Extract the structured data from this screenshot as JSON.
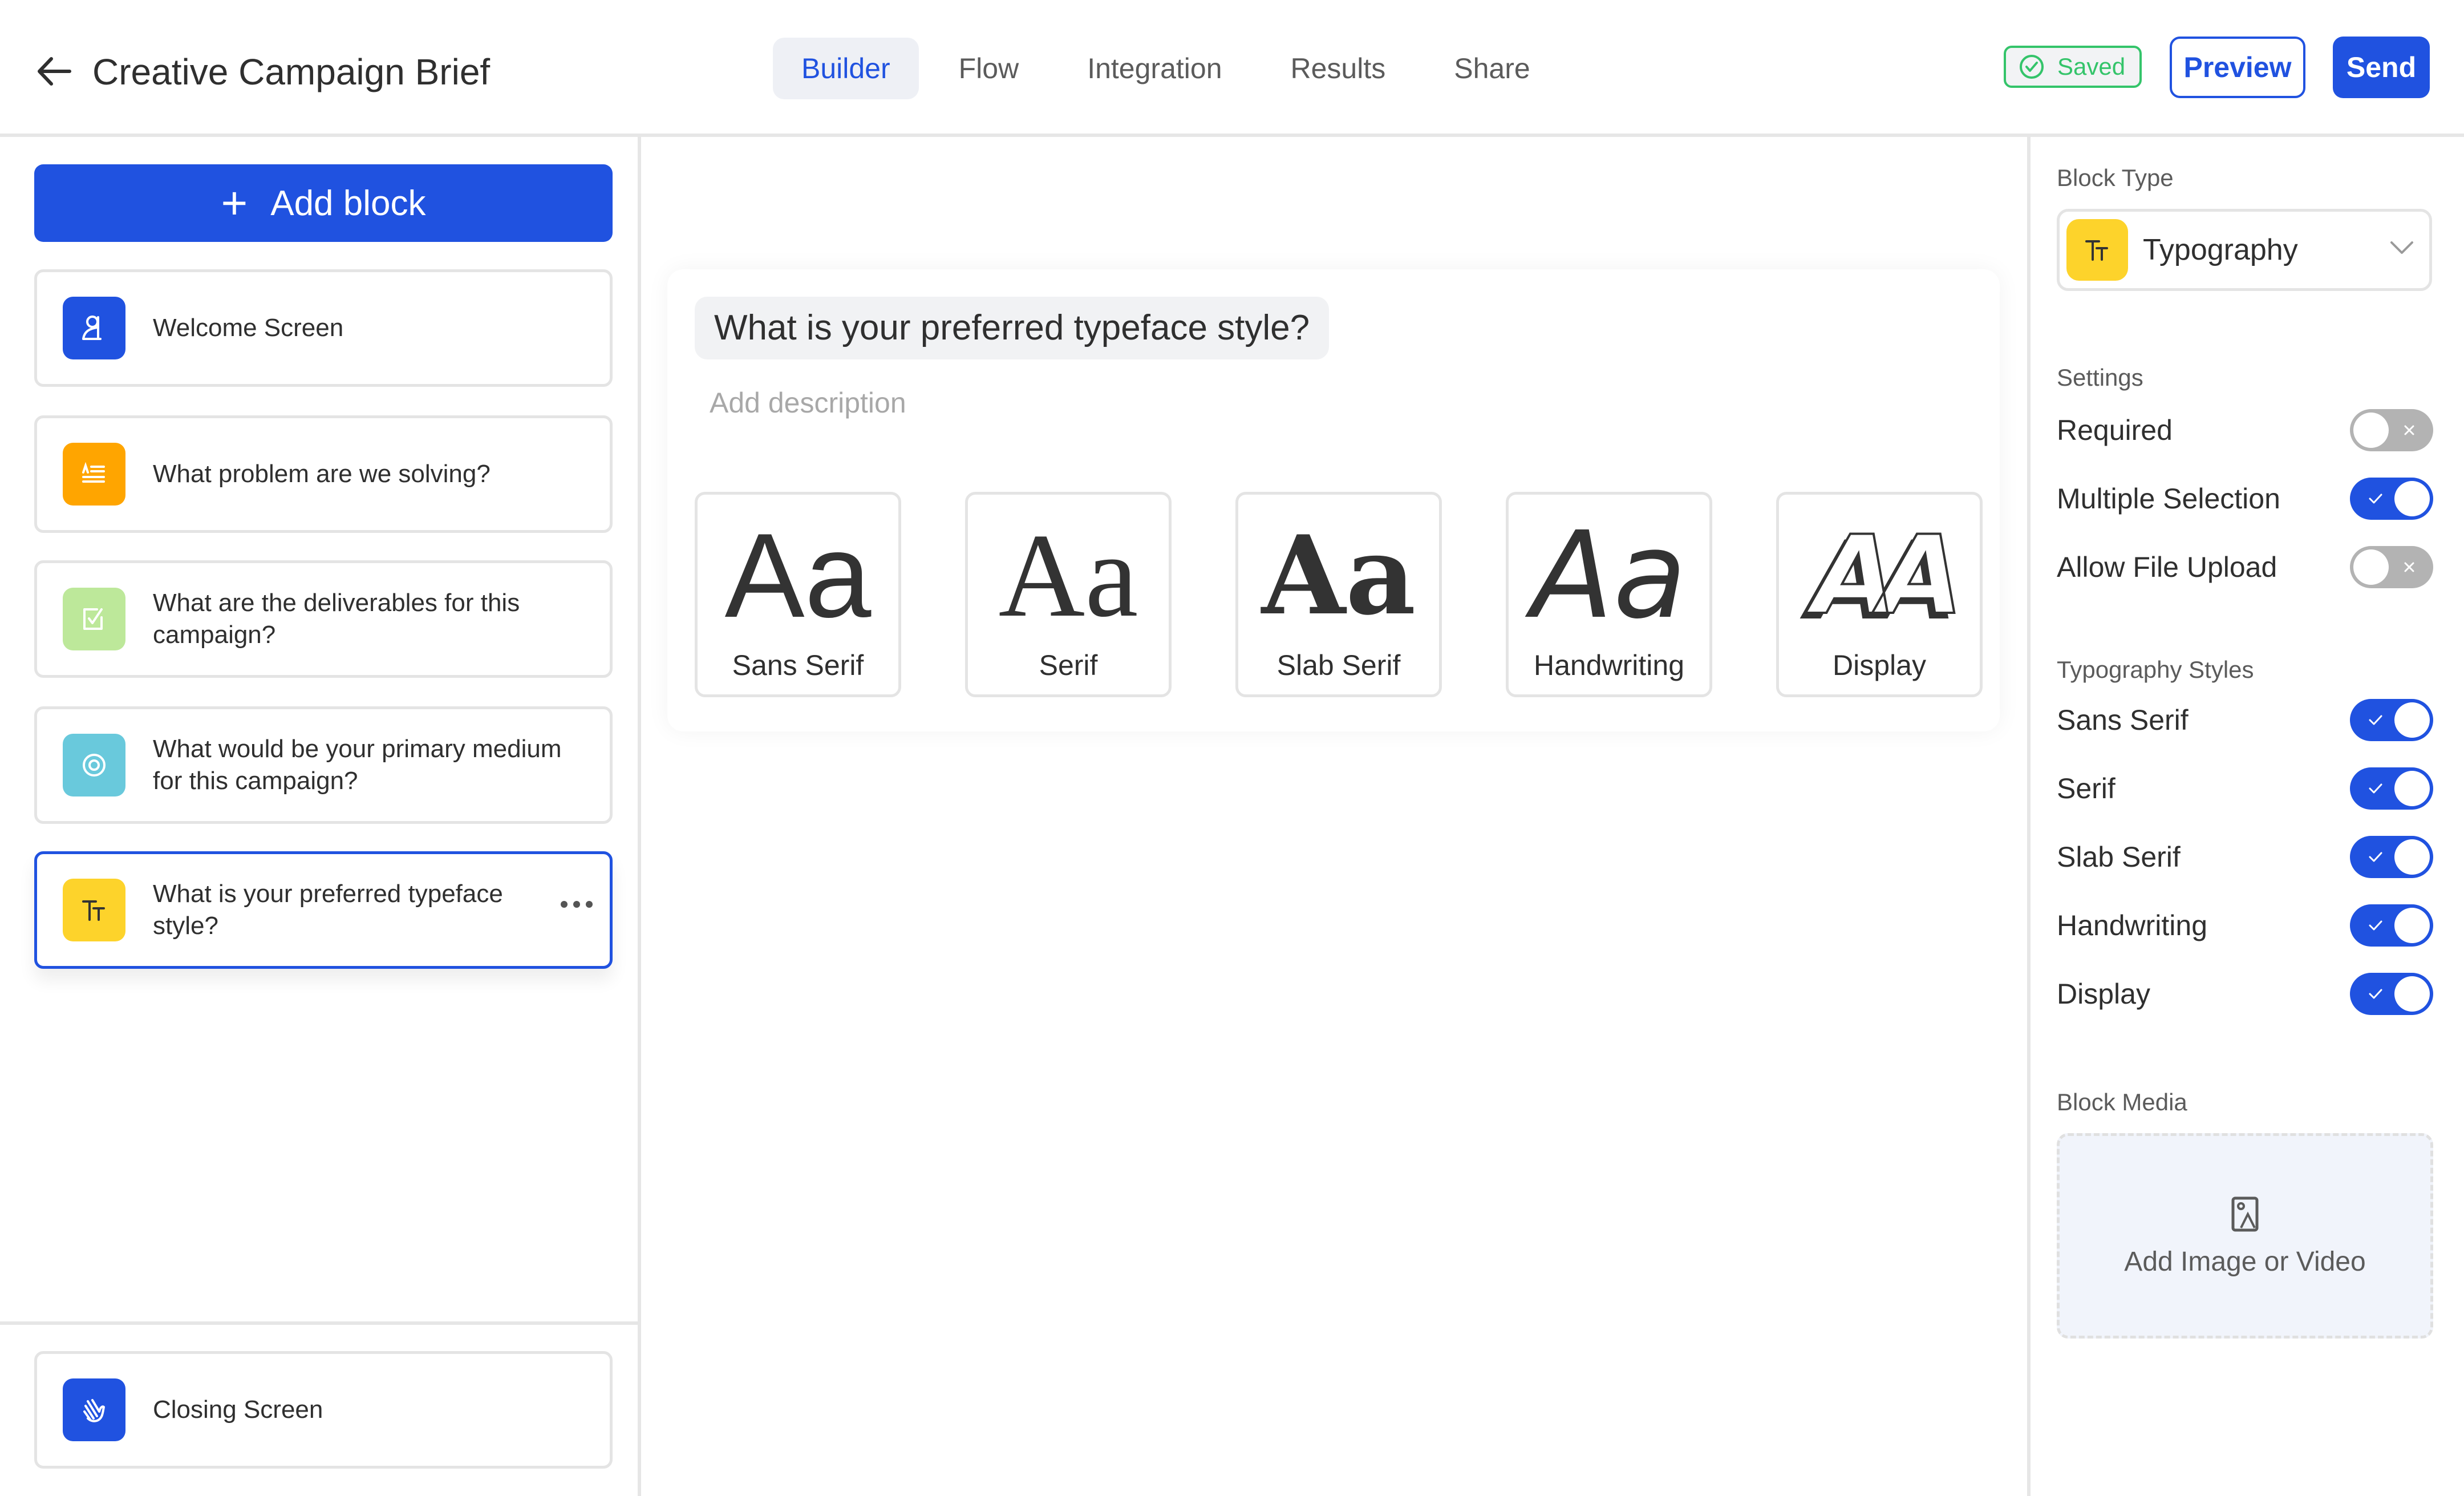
{
  "header": {
    "back_icon": "arrow-left-icon",
    "title": "Creative Campaign Brief",
    "tabs": [
      {
        "label": "Builder",
        "active": true
      },
      {
        "label": "Flow",
        "active": false
      },
      {
        "label": "Integration",
        "active": false
      },
      {
        "label": "Results",
        "active": false
      },
      {
        "label": "Share",
        "active": false
      }
    ],
    "saved_label": "Saved",
    "preview_label": "Preview",
    "send_label": "Send",
    "colors": {
      "accent": "#2052e0",
      "saved": "#34c46a"
    }
  },
  "sidebar": {
    "add_block_label": "Add block",
    "blocks": [
      {
        "label": "Welcome Screen",
        "icon": "welcome-icon",
        "color": "#2052e0",
        "selected": false
      },
      {
        "label": "What problem are we solving?",
        "icon": "long-text-icon",
        "color": "#ffa500",
        "selected": false
      },
      {
        "label": "What are the deliverables for this campaign?",
        "icon": "checkbox-icon",
        "color": "#bde89a",
        "selected": false
      },
      {
        "label": "What would be your primary medium for this campaign?",
        "icon": "radio-icon",
        "color": "#69c9dc",
        "selected": false
      },
      {
        "label": "What is your preferred typeface style?",
        "icon": "typography-icon",
        "color": "#fdd32b",
        "selected": true
      }
    ],
    "closing": {
      "label": "Closing Screen",
      "icon": "wave-hand-icon",
      "color": "#2052e0"
    }
  },
  "canvas": {
    "question": "What is your preferred typeface style?",
    "description_placeholder": "Add description",
    "options": [
      {
        "glyph": "Aa",
        "label": "Sans Serif",
        "style": "sans"
      },
      {
        "glyph": "Aa",
        "label": "Serif",
        "style": "serif"
      },
      {
        "glyph": "Aa",
        "label": "Slab Serif",
        "style": "slab"
      },
      {
        "glyph": "Aa",
        "label": "Handwriting",
        "style": "hand"
      },
      {
        "glyph": "AA",
        "label": "Display",
        "style": "display"
      }
    ]
  },
  "panel": {
    "block_type_label": "Block Type",
    "block_type_value": "Typography",
    "settings_label": "Settings",
    "settings": [
      {
        "label": "Required",
        "on": false
      },
      {
        "label": "Multiple Selection",
        "on": true
      },
      {
        "label": "Allow File Upload",
        "on": false
      }
    ],
    "typography_label": "Typography Styles",
    "typography_styles": [
      {
        "label": "Sans Serif",
        "on": true
      },
      {
        "label": "Serif",
        "on": true
      },
      {
        "label": "Slab Serif",
        "on": true
      },
      {
        "label": "Handwriting",
        "on": true
      },
      {
        "label": "Display",
        "on": true
      }
    ],
    "media_label": "Block Media",
    "media_cta": "Add Image or Video"
  }
}
